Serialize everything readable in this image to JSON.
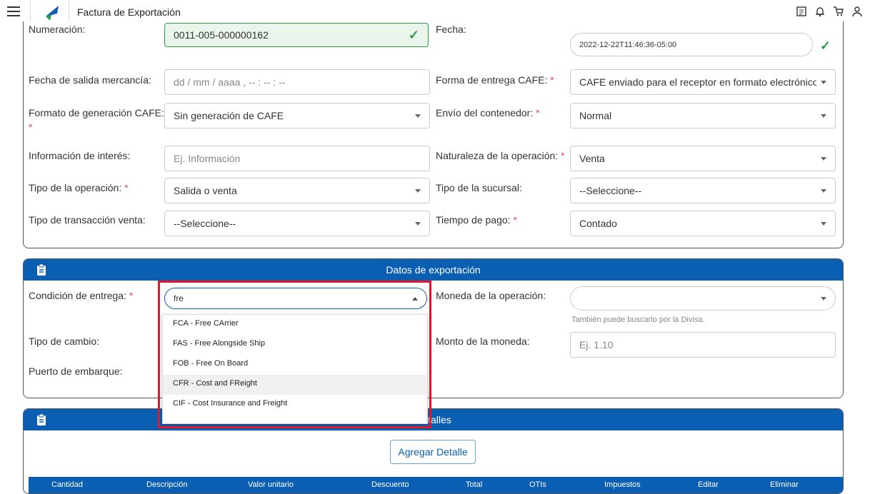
{
  "app": {
    "title": "Factura de Exportación"
  },
  "section1": {
    "numeracion_label": "Numeración:",
    "numeracion_value": "0011-005-000000162",
    "fecha_label": "Fecha:",
    "fecha_value": "2022-12-22T11:46:36-05:00",
    "fecha_salida_label": "Fecha de salida mercancía:",
    "fecha_salida_placeholder": "dd / mm / aaaa ,  -- : -- : --",
    "forma_entrega_label": "Forma de entrega CAFE:",
    "forma_entrega_value": "CAFE enviado para el receptor en formato electrónico.",
    "formato_label": "Formato de generación CAFE:",
    "formato_value": "Sin generación de CAFE",
    "envio_label": "Envío del contenedor:",
    "envio_value": "Normal",
    "info_label": "Información de interés:",
    "info_placeholder": "Ej. Información",
    "naturaleza_label": "Naturaleza de la operación:",
    "naturaleza_value": "Venta",
    "tipo_operacion_label": "Tipo de la operación:",
    "tipo_operacion_value": "Salida o venta",
    "tipo_sucursal_label": "Tipo de la sucursal:",
    "tipo_sucursal_value": "--Seleccione--",
    "tipo_transaccion_label": "Tipo de transacción venta:",
    "tipo_transaccion_value": "--Seleccione--",
    "tiempo_pago_label": "Tiempo de pago:",
    "tiempo_pago_value": "Contado",
    "required_mark": "*"
  },
  "export": {
    "header": "Datos de exportación",
    "condicion_label": "Condición de entrega:",
    "condicion_input": "fre",
    "moneda_label": "Moneda de la operación:",
    "moneda_help": "También puede buscarlo por la Divisa.",
    "tipo_cambio_label": "Tipo de cambio:",
    "monto_label": "Monto de la moneda:",
    "monto_placeholder": "Ej. 1.10",
    "puerto_label": "Puerto de embarque:",
    "options": [
      "FCA - Free CArrier",
      "FAS - Free Alongside Ship",
      "FOB - Free On Board",
      "CFR - Cost and FReight",
      "CIF - Cost Insurance and Freight"
    ]
  },
  "details": {
    "header": "Detalles",
    "add_button": "Agregar Detalle",
    "columns": [
      "Cantidad",
      "Descripción",
      "Valor unitario",
      "Descuento",
      "Total",
      "OTIs",
      "Impuestos",
      "Editar",
      "Eliminar"
    ]
  },
  "colors": {
    "primary": "#0a5fb2",
    "success": "#2e9a46",
    "highlight": "#e2182a"
  }
}
